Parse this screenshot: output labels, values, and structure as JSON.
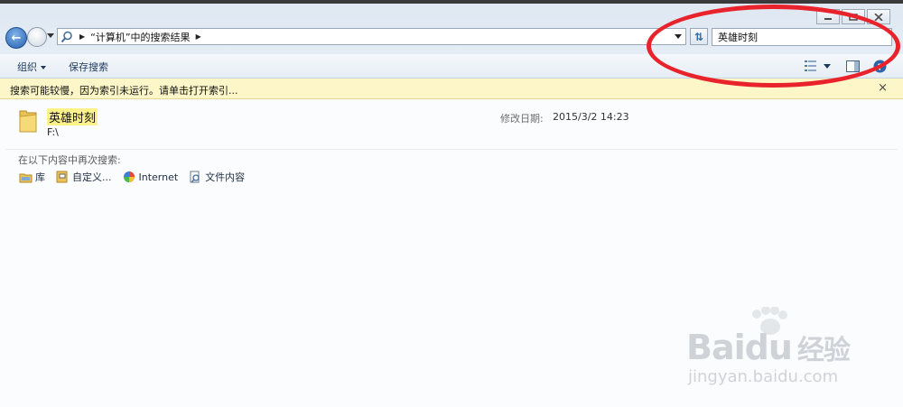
{
  "address_bar": {
    "text": "“计算机”中的搜索结果"
  },
  "search_box": {
    "value": "英雄时刻"
  },
  "toolbar": {
    "organize_label": "组织",
    "save_search_label": "保存搜索"
  },
  "info_bar": {
    "message": "搜索可能较慢，因为索引未运行。请单击打开索引...",
    "close_glyph": "×"
  },
  "results": [
    {
      "name": "英雄时刻",
      "path": "F:\\",
      "modified_label": "修改日期:",
      "modified_value": "2015/3/2 14:23"
    }
  ],
  "search_again": {
    "label": "在以下内容中再次搜索:",
    "items": [
      "库",
      "自定义...",
      "Internet",
      "文件内容"
    ]
  },
  "watermark": {
    "brand": "Bai",
    "brand2": "du",
    "cn": "经验",
    "url": "jingyan.baidu.com"
  },
  "colors": {
    "annotation": "#e8232c",
    "info_bar_bg": "#fdf6c8",
    "highlight": "#fcf28a",
    "back_button": "#2860b0"
  }
}
